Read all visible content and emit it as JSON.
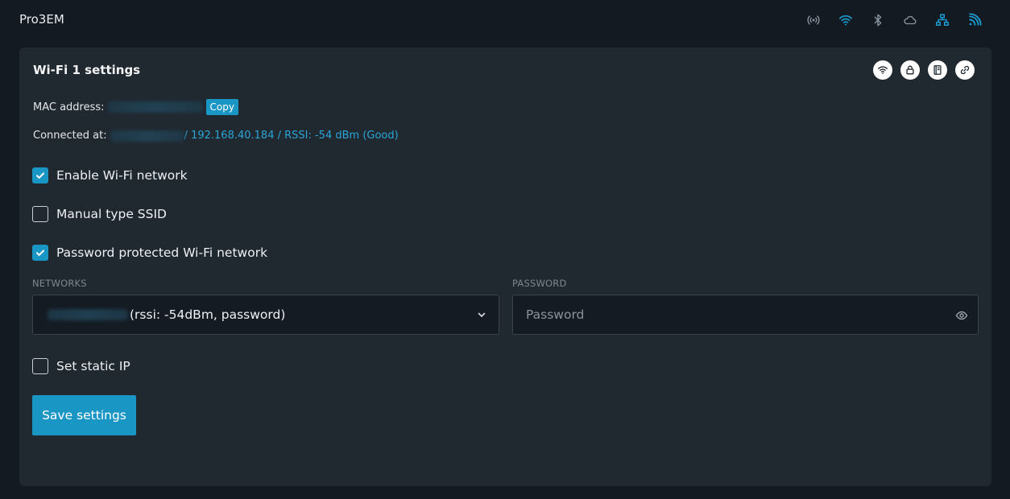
{
  "app": {
    "title": "Pro3EM"
  },
  "status_icons": [
    {
      "name": "broadcast-icon",
      "color": "#8a96a2"
    },
    {
      "name": "wifi-icon",
      "color": "#1a9ed4"
    },
    {
      "name": "bluetooth-icon",
      "color": "#8a96a2"
    },
    {
      "name": "cloud-icon",
      "color": "#8a96a2"
    },
    {
      "name": "ethernet-icon",
      "color": "#1a9ed4"
    },
    {
      "name": "rss-icon",
      "color": "#1a9ed4"
    }
  ],
  "card": {
    "title": "Wi-Fi 1 settings",
    "actions": [
      "wifi-icon",
      "lock-icon",
      "book-icon",
      "link-icon"
    ]
  },
  "mac": {
    "label": "MAC address:",
    "copy_label": "Copy"
  },
  "connected": {
    "label": "Connected at:",
    "details": " / 192.168.40.184 / RSSI: -54 dBm (Good)"
  },
  "checkboxes": {
    "enable_wifi": {
      "label": "Enable Wi-Fi network",
      "checked": true
    },
    "manual_ssid": {
      "label": "Manual type SSID",
      "checked": false
    },
    "password_protected": {
      "label": "Password protected Wi-Fi network",
      "checked": true
    },
    "static_ip": {
      "label": "Set static IP",
      "checked": false
    }
  },
  "networks": {
    "label": "NETWORKS",
    "selected_suffix": "(rssi: -54dBm, password)"
  },
  "password": {
    "label": "PASSWORD",
    "placeholder": "Password"
  },
  "save_button": {
    "label": "Save settings"
  },
  "colors": {
    "accent": "#1a96c4",
    "background": "#131a22",
    "card": "#202830"
  }
}
